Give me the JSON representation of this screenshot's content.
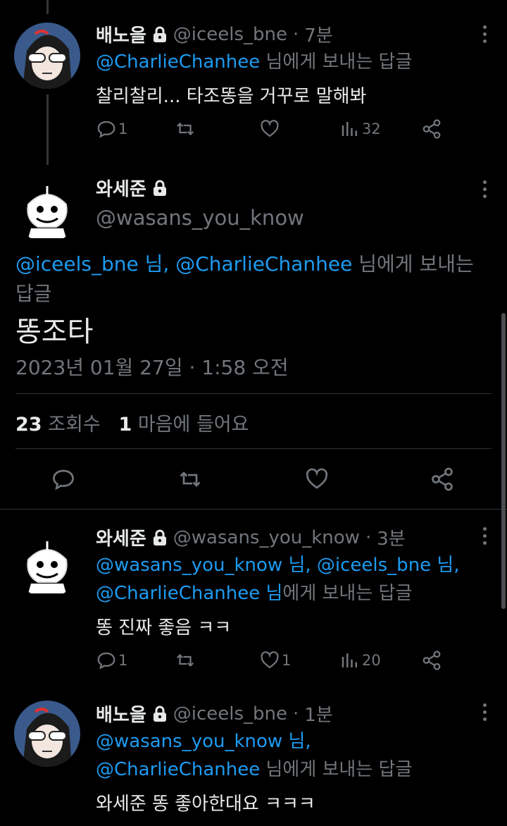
{
  "tweets": [
    {
      "name": "배노을",
      "handle": "@iceels_bne",
      "time": "7분",
      "reply_prefix": "",
      "reply_mentions": [
        "@CharlieChanhee"
      ],
      "reply_suffix": " 님에게 보내는 답글",
      "text": "찰리찰리... 타조똥을 거꾸로 말해봐",
      "replies": "1",
      "retweets": "",
      "likes": "",
      "views": "32"
    },
    {
      "name": "와세준",
      "handle": "@wasans_you_know",
      "time": "3분",
      "reply_line1_m1": "@wasans_you_know 님, ",
      "reply_line1_m2": "@iceels_bne 님,",
      "reply_line2_m": "@CharlieChanhee 님",
      "reply_suffix": "에게 보내는 답글",
      "text": "똥 진짜 좋음 ㅋㅋ",
      "replies": "1",
      "retweets": "",
      "likes": "1",
      "views": "20"
    },
    {
      "name": "배노을",
      "handle": "@iceels_bne",
      "time": "1분",
      "reply_line1_m": "@wasans_you_know 님,",
      "reply_line2_m": "@CharlieChanhee",
      "reply_suffix": " 님에게 보내는 답글",
      "text": "와세준 똥 좋아한대요 ㅋㅋㅋ",
      "replies": "",
      "retweets": "",
      "likes": "",
      "views": ""
    }
  ],
  "focus": {
    "name": "와세준",
    "handle": "@wasans_you_know",
    "reply_m1": "@iceels_bne 님, ",
    "reply_m2": "@CharlieChanhee",
    "reply_suffix": " 님에게 보내는 답글",
    "text": "똥조타",
    "date": "2023년 01월 27일 · 1:58 오전",
    "views_count": "23",
    "views_label": "조회수",
    "likes_count": "1",
    "likes_label": "마음에 들어요"
  },
  "colors": {
    "background": "#000000",
    "text": "#e7e9ea",
    "muted": "#71767b",
    "link": "#1d9bf0",
    "divider": "#2f3336"
  },
  "icons": [
    "lock-icon",
    "more-icon",
    "reply-icon",
    "retweet-icon",
    "like-icon",
    "views-icon",
    "share-icon"
  ]
}
